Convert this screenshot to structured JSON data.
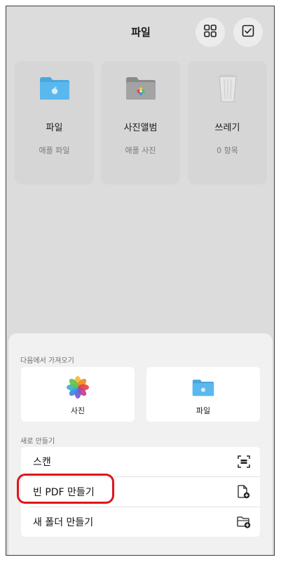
{
  "header": {
    "title": "파일"
  },
  "cards": [
    {
      "name": "파일",
      "subtitle": "애플 파일",
      "icon": "folder-icon"
    },
    {
      "name": "사진앨범",
      "subtitle": "애플 사진",
      "icon": "photos-folder-icon"
    },
    {
      "name": "쓰레기",
      "subtitle": "0 항목",
      "icon": "trash-icon"
    }
  ],
  "sheet": {
    "import_label": "다음에서 가져오기",
    "import_sources": [
      {
        "label": "사진",
        "icon": "photos-icon"
      },
      {
        "label": "파일",
        "icon": "folder-icon"
      }
    ],
    "create_label": "새로 만들기",
    "create_items": [
      {
        "label": "스캔",
        "icon": "scan-icon"
      },
      {
        "label": "빈 PDF 만들기",
        "icon": "new-document-icon"
      },
      {
        "label": "새 폴더 만들기",
        "icon": "new-folder-icon"
      }
    ]
  },
  "colors": {
    "folder_blue": "#5ab8ee",
    "highlight_red": "#e0141a"
  }
}
